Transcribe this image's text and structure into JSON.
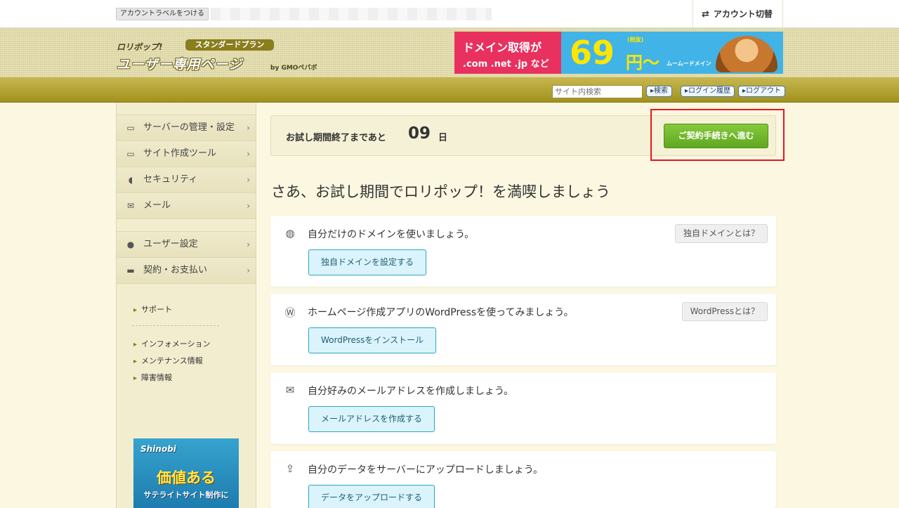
{
  "topbar": {
    "account_label_button": "アカウントラベルをつける",
    "account_switch": "アカウント切替"
  },
  "header": {
    "logo_small": "ロリポップ!",
    "plan_badge": "スタンダードプラン",
    "logo_main": "ユーザー専用ページ",
    "logo_by": "by GMOペパボ",
    "banner": {
      "line1": "ドメイン取得が",
      "line2": ".com .net .jp など",
      "price": "69",
      "tax": "(税抜)",
      "yen": "円〜",
      "brand": "ムームードメイン"
    }
  },
  "navband": {
    "search_placeholder": "サイト内検索",
    "search_button": "検索",
    "login_history_button": "ログイン履歴",
    "logout_button": "ログアウト"
  },
  "sidebar": {
    "items": [
      {
        "label": "サーバーの管理・設定",
        "icon": "server-icon"
      },
      {
        "label": "サイト作成ツール",
        "icon": "laptop-icon"
      },
      {
        "label": "セキュリティ",
        "icon": "shield-icon"
      },
      {
        "label": "メール",
        "icon": "mail-icon"
      }
    ],
    "items2": [
      {
        "label": "ユーザー設定",
        "icon": "user-icon"
      },
      {
        "label": "契約・お支払い",
        "icon": "credit-card-icon"
      }
    ],
    "links": {
      "support": "サポート",
      "information": "インフォメーション",
      "maintenance": "メンテナンス情報",
      "failure": "障害情報"
    },
    "ad": {
      "brand": "Shinobi",
      "headline": "価値ある",
      "sub": "サテライトサイト制作に"
    }
  },
  "trial": {
    "text": "お試し期間終了まであと",
    "days": "09",
    "unit": "日",
    "contract_button": "ご契約手続きへ進む"
  },
  "main": {
    "title": "さあ、お試し期間でロリポップ！を満喫しましょう",
    "cards": [
      {
        "icon": "globe-icon",
        "text": "自分だけのドメインを使いましょう。",
        "help": "独自ドメインとは？",
        "action": "独自ドメインを設定する"
      },
      {
        "icon": "wordpress-icon",
        "text": "ホームページ作成アプリのWordPressを使ってみましょう。",
        "help": "WordPressとは？",
        "action": "WordPressをインストール"
      },
      {
        "icon": "envelope-icon",
        "text": "自分好みのメールアドレスを作成しましょう。",
        "help": "",
        "action": "メールアドレスを作成する"
      },
      {
        "icon": "upload-icon",
        "text": "自分のデータをサーバーにアップロードしましょう。",
        "help": "",
        "action": "データをアップロードする"
      }
    ]
  },
  "colors": {
    "accent_green": "#6bb82a",
    "highlight_red": "#e8161d",
    "action_blue": "#2aa6c6"
  }
}
